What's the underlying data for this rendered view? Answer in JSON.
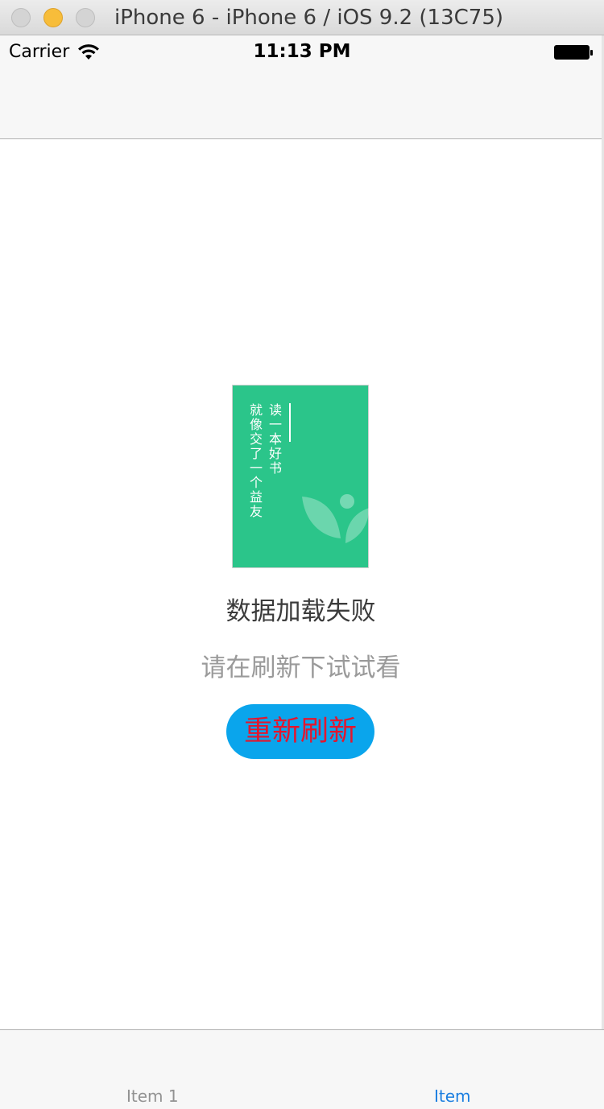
{
  "window": {
    "title": "iPhone 6 - iPhone 6 / iOS 9.2 (13C75)"
  },
  "status_bar": {
    "carrier": "Carrier",
    "time": "11:13 PM"
  },
  "book_image": {
    "line1": "读一本好书",
    "line2": "就像交了一个益友"
  },
  "error": {
    "title": "数据加载失败",
    "subtitle": "请在刷新下试试看",
    "retry_label": "重新刷新"
  },
  "tab_bar": {
    "items": [
      {
        "label": "Item 1",
        "selected": false
      },
      {
        "label": "Item",
        "selected": true
      }
    ]
  },
  "colors": {
    "book_green": "#2bc58a",
    "retry_button_bg": "#0aa5ec",
    "retry_button_text": "#e3162e",
    "tab_selected": "#1a7ee0",
    "tab_unselected": "#929292"
  }
}
